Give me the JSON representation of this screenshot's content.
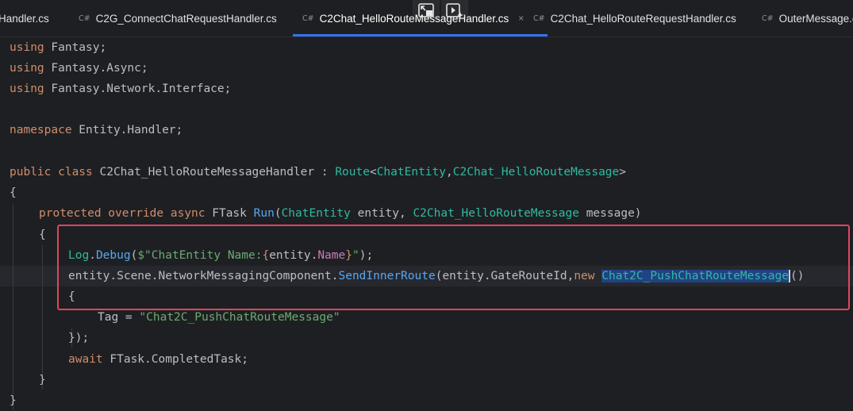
{
  "tabs": [
    {
      "icon": "",
      "label": "Handler.cs"
    },
    {
      "icon": "C#",
      "label": "C2G_ConnectChatRequestHandler.cs"
    },
    {
      "icon": "C#",
      "label": "C2Chat_HelloRouteMessageHandler.cs",
      "close": "×"
    },
    {
      "icon": "C#",
      "label": "C2Chat_HelloRouteRequestHandler.cs"
    },
    {
      "icon": "C#",
      "label": "OuterMessage.cs"
    }
  ],
  "code": {
    "l1": {
      "a": "using",
      "b": " Fantasy;"
    },
    "l2": {
      "a": "using",
      "b": " Fantasy.Async;"
    },
    "l3": {
      "a": "using",
      "b": " Fantasy.Network.Interface;"
    },
    "l5": {
      "a": "namespace",
      "b": " Entity.Handler;"
    },
    "l7": {
      "a": "public class",
      "b": " C2Chat_HelloRouteMessageHandler : ",
      "c": "Route",
      "d": "<",
      "e": "ChatEntity",
      "f": ",",
      "g": "C2Chat_HelloRouteMessage",
      "h": ">"
    },
    "l8": "{",
    "l9": {
      "a": "protected override async",
      "b": " FTask ",
      "c": "Run",
      "d": "(",
      "e": "ChatEntity",
      "f": " entity, ",
      "g": "C2Chat_HelloRouteMessage",
      "h": " message)"
    },
    "l10": "{",
    "l11": {
      "a": "Log",
      "b": ".",
      "c": "Debug",
      "d": "(",
      "e": "$\"ChatEntity Name:",
      "f": "{",
      "g": "entity",
      "h": ".",
      "i": "Name",
      "j": "}",
      "k": "\"",
      "l": ");"
    },
    "l12": {
      "a": "entity",
      "b": ".Scene.NetworkMessagingComponent.",
      "c": "SendInnerRoute",
      "d": "(",
      "e": "entity",
      "f": ".GateRouteId,",
      "g": "new",
      "h": " ",
      "i": "Chat2C_PushChatRouteMessage",
      "j": "()"
    },
    "l13": "{",
    "l14": {
      "a": "Tag",
      "b": " = ",
      "c": "\"Chat2C_PushChatRouteMessage\""
    },
    "l15": "});",
    "l16": {
      "a": "await",
      "b": " FTask",
      "c": ".CompletedTask;"
    },
    "l17": "}",
    "l18": "}"
  }
}
